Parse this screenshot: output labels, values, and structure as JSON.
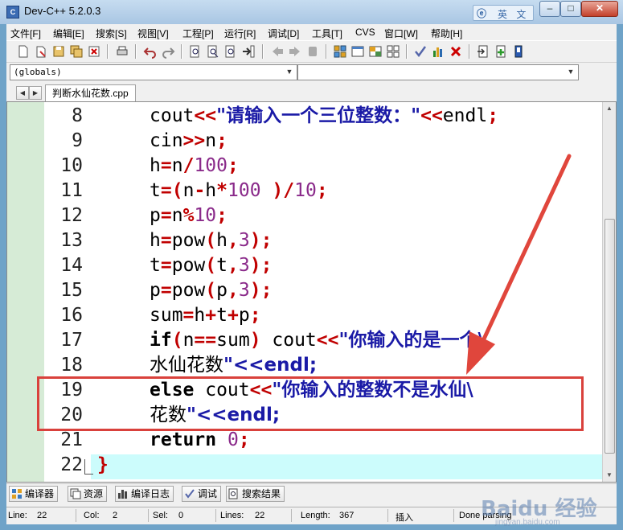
{
  "window": {
    "title": "Dev-C++ 5.2.0.3",
    "ime_label": "英 文",
    "ime_logo": "ⓔ",
    "min": "–",
    "max": "□",
    "close": "✕"
  },
  "menu": [
    "文件[F]",
    "编辑[E]",
    "搜索[S]",
    "视图[V]",
    "工程[P]",
    "运行[R]",
    "调试[D]",
    "工具[T]",
    "CVS",
    "窗口[W]",
    "帮助[H]"
  ],
  "combo": {
    "scope": "(globals)",
    "symbol": ""
  },
  "tab": {
    "file": "判断水仙花数.cpp",
    "left": "◀",
    "right": "▶"
  },
  "editor": {
    "lines": [
      {
        "n": "8",
        "text": "    cout<<\"请输入一个三位整数：\"<<endl;"
      },
      {
        "n": "9",
        "text": "    cin>>n;"
      },
      {
        "n": "10",
        "text": "    h=n/100;"
      },
      {
        "n": "11",
        "text": "    t=(n-h*100 )/10;"
      },
      {
        "n": "12",
        "text": "    p=n%10;"
      },
      {
        "n": "13",
        "text": "    h=pow(h,3);"
      },
      {
        "n": "14",
        "text": "    t=pow(t,3);"
      },
      {
        "n": "15",
        "text": "    p=pow(p,3);"
      },
      {
        "n": "16",
        "text": "    sum=h+t+p;"
      },
      {
        "n": "17",
        "text": "    if(n==sum) cout<<\"你输入的是一个\\"
      },
      {
        "n": "18",
        "text": "水仙花数\"<<endl;"
      },
      {
        "n": "19",
        "text": "    else cout<<\"你输入的整数不是水仙\\"
      },
      {
        "n": "20",
        "text": "花数\"<<endl;"
      },
      {
        "n": "21",
        "text": "    return 0;"
      },
      {
        "n": "22",
        "text": "}"
      }
    ]
  },
  "bottom_tabs": [
    "编译器",
    "资源",
    "编译日志",
    "调试",
    "搜索结果"
  ],
  "status": {
    "line_label": "Line:",
    "line": "22",
    "col_label": "Col:",
    "col": "2",
    "sel_label": "Sel:",
    "sel": "0",
    "lines_label": "Lines:",
    "lines": "22",
    "length_label": "Length:",
    "length": "367",
    "mode": "插入",
    "parse": "Done parsing"
  },
  "watermark": {
    "text": "Baidu 经验",
    "url": "jingyan.baidu.com"
  },
  "colors": {
    "operator": "#c00000",
    "string": "#1a1aa6",
    "number": "#8a2a8a",
    "highlight": "#d9413c",
    "active_line": "#ccfcfc",
    "gutter": "#d6ebd6"
  }
}
